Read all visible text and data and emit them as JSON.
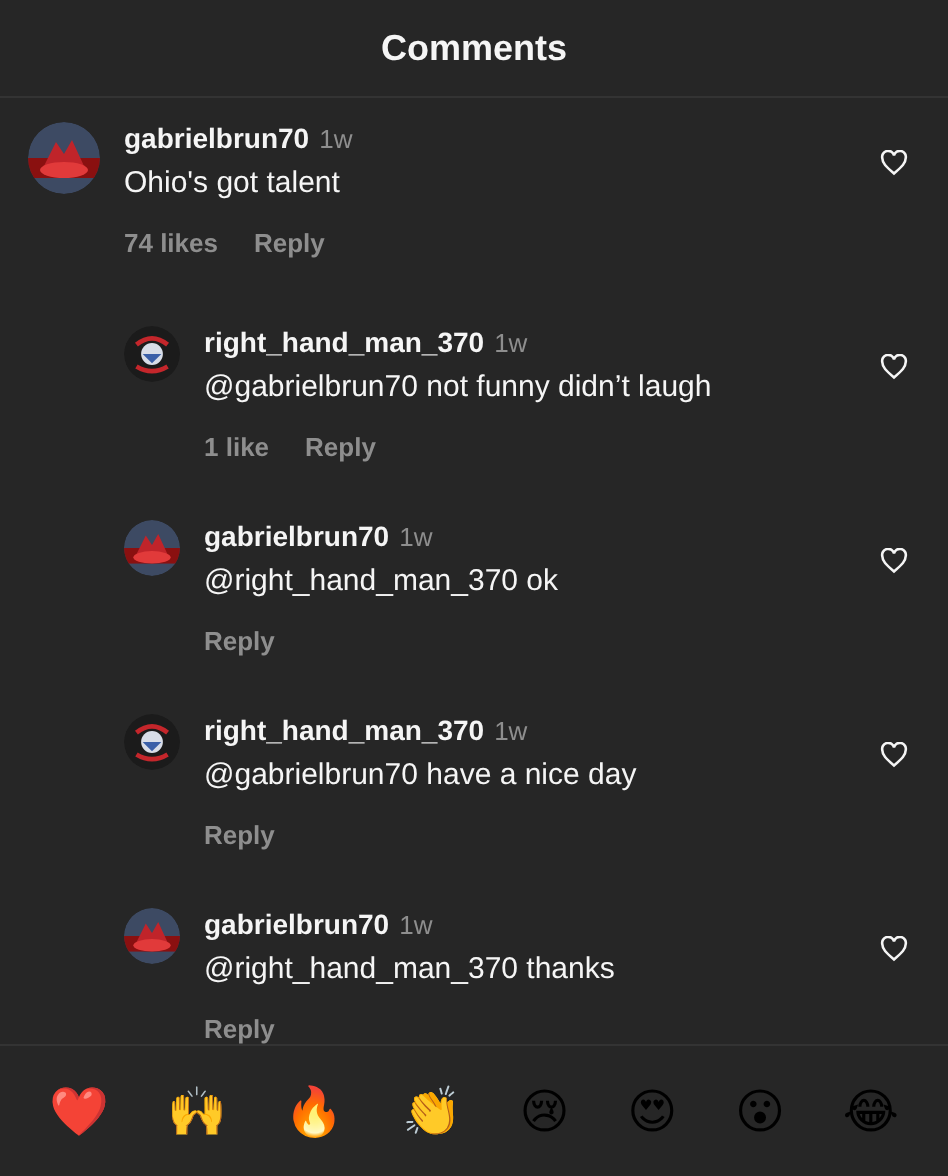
{
  "header": {
    "title": "Comments"
  },
  "comments": [
    {
      "user": "gabrielbrun70",
      "time": "1w",
      "text": "Ohio's got talent",
      "likes": "74 likes",
      "reply": "Reply",
      "kind": "red",
      "reply_level": false
    },
    {
      "user": "right_hand_man_370",
      "time": "1w",
      "text": "@gabrielbrun70 not funny didn’t laugh",
      "likes": "1 like",
      "reply": "Reply",
      "kind": "badge",
      "reply_level": true
    },
    {
      "user": "gabrielbrun70",
      "time": "1w",
      "text": "@right_hand_man_370 ok",
      "reply": "Reply",
      "kind": "red",
      "reply_level": true
    },
    {
      "user": "right_hand_man_370",
      "time": "1w",
      "text": "@gabrielbrun70 have a nice day",
      "reply": "Reply",
      "kind": "badge",
      "reply_level": true
    },
    {
      "user": "gabrielbrun70",
      "time": "1w",
      "text": "@right_hand_man_370 thanks",
      "reply": "Reply",
      "kind": "red",
      "reply_level": true
    }
  ],
  "reactions": [
    "❤️",
    "🙌",
    "🔥",
    "👏",
    "😢",
    "😍",
    "😮",
    "😂"
  ]
}
